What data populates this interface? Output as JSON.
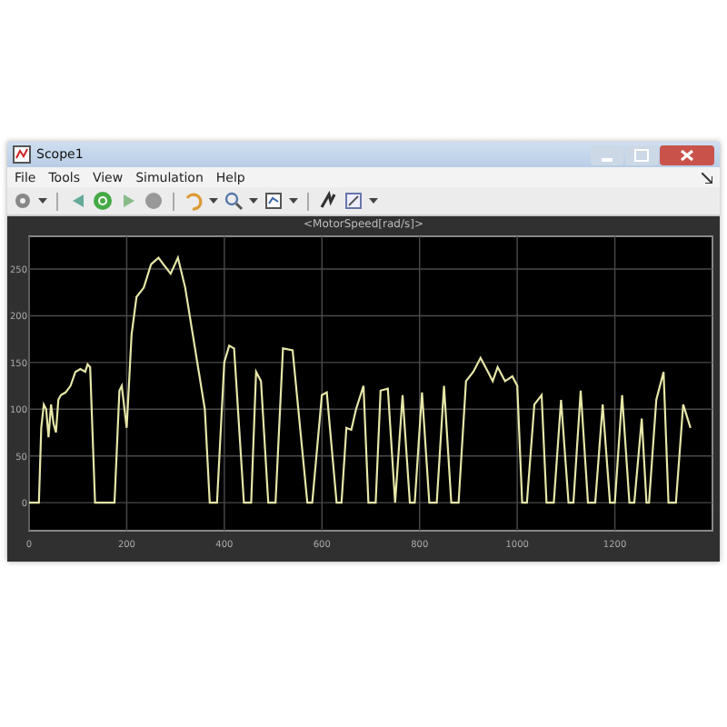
{
  "window": {
    "title": "Scope1"
  },
  "menu": [
    {
      "label": "File"
    },
    {
      "label": "Tools"
    },
    {
      "label": "View"
    },
    {
      "label": "Simulation"
    },
    {
      "label": "Help"
    }
  ],
  "plot": {
    "chart_data": {
      "type": "line",
      "title": "<MotorSpeed[rad/s]>",
      "xlim": [
        0,
        1400
      ],
      "ylim": [
        -30,
        285
      ],
      "xticks": [
        0,
        200,
        400,
        600,
        800,
        1000,
        1200
      ],
      "yticks": [
        0,
        50,
        100,
        150,
        200,
        250
      ],
      "grid": true,
      "x": [
        0,
        20,
        25,
        30,
        35,
        40,
        45,
        50,
        55,
        60,
        65,
        75,
        85,
        95,
        105,
        115,
        120,
        125,
        135,
        175,
        185,
        190,
        200,
        210,
        220,
        235,
        250,
        265,
        275,
        290,
        305,
        320,
        360,
        370,
        385,
        400,
        410,
        420,
        440,
        455,
        465,
        475,
        490,
        505,
        520,
        540,
        570,
        580,
        600,
        610,
        630,
        640,
        650,
        660,
        670,
        685,
        695,
        710,
        720,
        735,
        750,
        765,
        780,
        790,
        805,
        820,
        835,
        850,
        865,
        880,
        895,
        910,
        925,
        940,
        950,
        960,
        975,
        990,
        1000,
        1010,
        1020,
        1035,
        1050,
        1060,
        1075,
        1090,
        1105,
        1115,
        1130,
        1145,
        1160,
        1175,
        1190,
        1200,
        1215,
        1230,
        1240,
        1255,
        1265,
        1270,
        1285,
        1300,
        1310,
        1325,
        1340,
        1355
      ],
      "series": [
        {
          "color": "#e6e6a8",
          "values": [
            0,
            0,
            80,
            105,
            100,
            70,
            105,
            85,
            75,
            110,
            115,
            118,
            125,
            140,
            143,
            140,
            148,
            145,
            0,
            0,
            120,
            125,
            80,
            180,
            220,
            230,
            255,
            262,
            255,
            245,
            262,
            230,
            100,
            0,
            0,
            150,
            168,
            165,
            0,
            0,
            140,
            130,
            0,
            0,
            165,
            163,
            0,
            0,
            115,
            118,
            0,
            0,
            80,
            78,
            100,
            125,
            0,
            0,
            120,
            122,
            0,
            115,
            0,
            0,
            118,
            0,
            0,
            125,
            0,
            0,
            130,
            140,
            155,
            140,
            130,
            145,
            130,
            135,
            125,
            0,
            0,
            105,
            115,
            0,
            0,
            110,
            0,
            0,
            120,
            0,
            0,
            105,
            0,
            0,
            115,
            0,
            0,
            90,
            0,
            0,
            110,
            140,
            0,
            0,
            105,
            80
          ]
        }
      ]
    }
  }
}
